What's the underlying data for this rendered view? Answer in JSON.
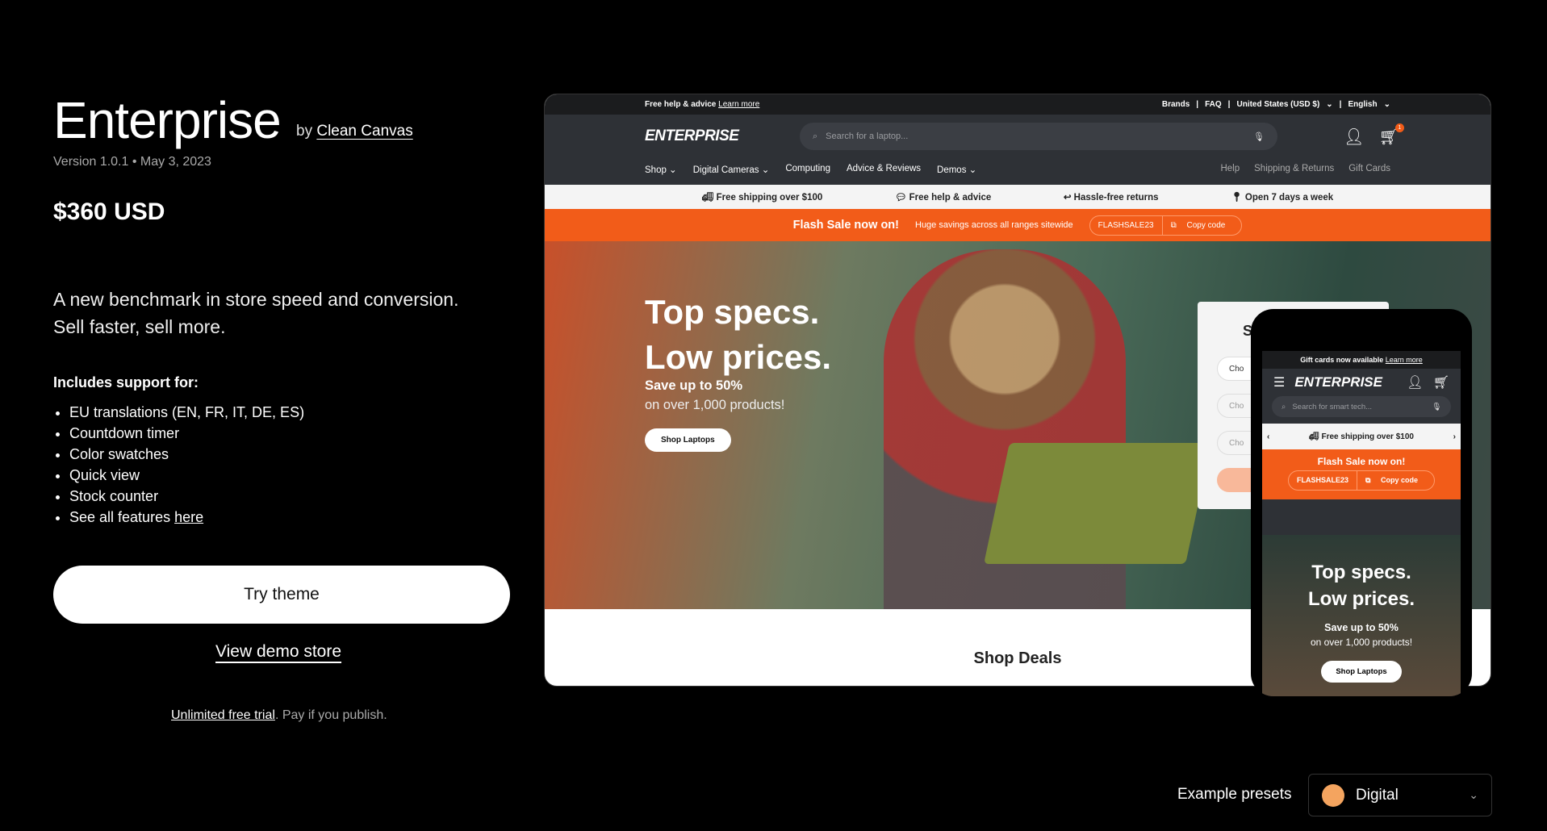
{
  "theme": {
    "title": "Enterprise",
    "by": "by",
    "author": "Clean Canvas",
    "version": "Version 1.0.1 • May 3, 2023",
    "price": "$360 USD",
    "tagline_1": "A new benchmark in store speed and conversion.",
    "tagline_2": "Sell faster, sell more.",
    "includes_heading": "Includes support for:",
    "features": [
      "EU translations (EN, FR, IT, DE, ES)",
      "Countdown timer",
      "Color swatches",
      "Quick view",
      "Stock counter"
    ],
    "see_all": "See all features ",
    "see_all_link": "here",
    "try_label": "Try theme",
    "demo_label": "View demo store",
    "trial_link": "Unlimited free trial",
    "trial_rest": ". Pay if you publish.",
    "presets_label": "Example presets",
    "preset_value": "Digital",
    "preset_color": "#f4a45f"
  },
  "preview": {
    "topbar": {
      "help": "Free help & advice",
      "learn": "Learn more",
      "brands": "Brands",
      "faq": "FAQ",
      "country": "United States (USD $)",
      "language": "English"
    },
    "logo": "ENTERPRISE",
    "search_placeholder": "Search for a laptop...",
    "cart_count": "1",
    "nav": [
      "Shop",
      "Digital Cameras",
      "Computing",
      "Advice & Reviews",
      "Demos"
    ],
    "nav_right": [
      "Help",
      "Shipping & Returns",
      "Gift Cards"
    ],
    "usps": [
      "Free shipping over $100",
      "Free help & advice",
      "Hassle-free returns",
      "Open 7 days a week"
    ],
    "flash": {
      "title": "Flash Sale now on!",
      "text": "Huge savings across all ranges sitewide",
      "code": "FLASHSALE23",
      "copy": "Copy code"
    },
    "hero": {
      "line1": "Top specs.",
      "line2": "Low prices.",
      "save": "Save up to 50%",
      "sub": "on over 1,000 products!",
      "button": "Shop Laptops"
    },
    "card_pill": "Cho",
    "card_title": "S",
    "deals": "Shop Deals",
    "mobile": {
      "topbar": "Gift cards now available",
      "learn": "Learn more",
      "search_placeholder": "Search for smart tech...",
      "usp": "Free shipping over $100"
    },
    "accent": "#f25c19"
  }
}
